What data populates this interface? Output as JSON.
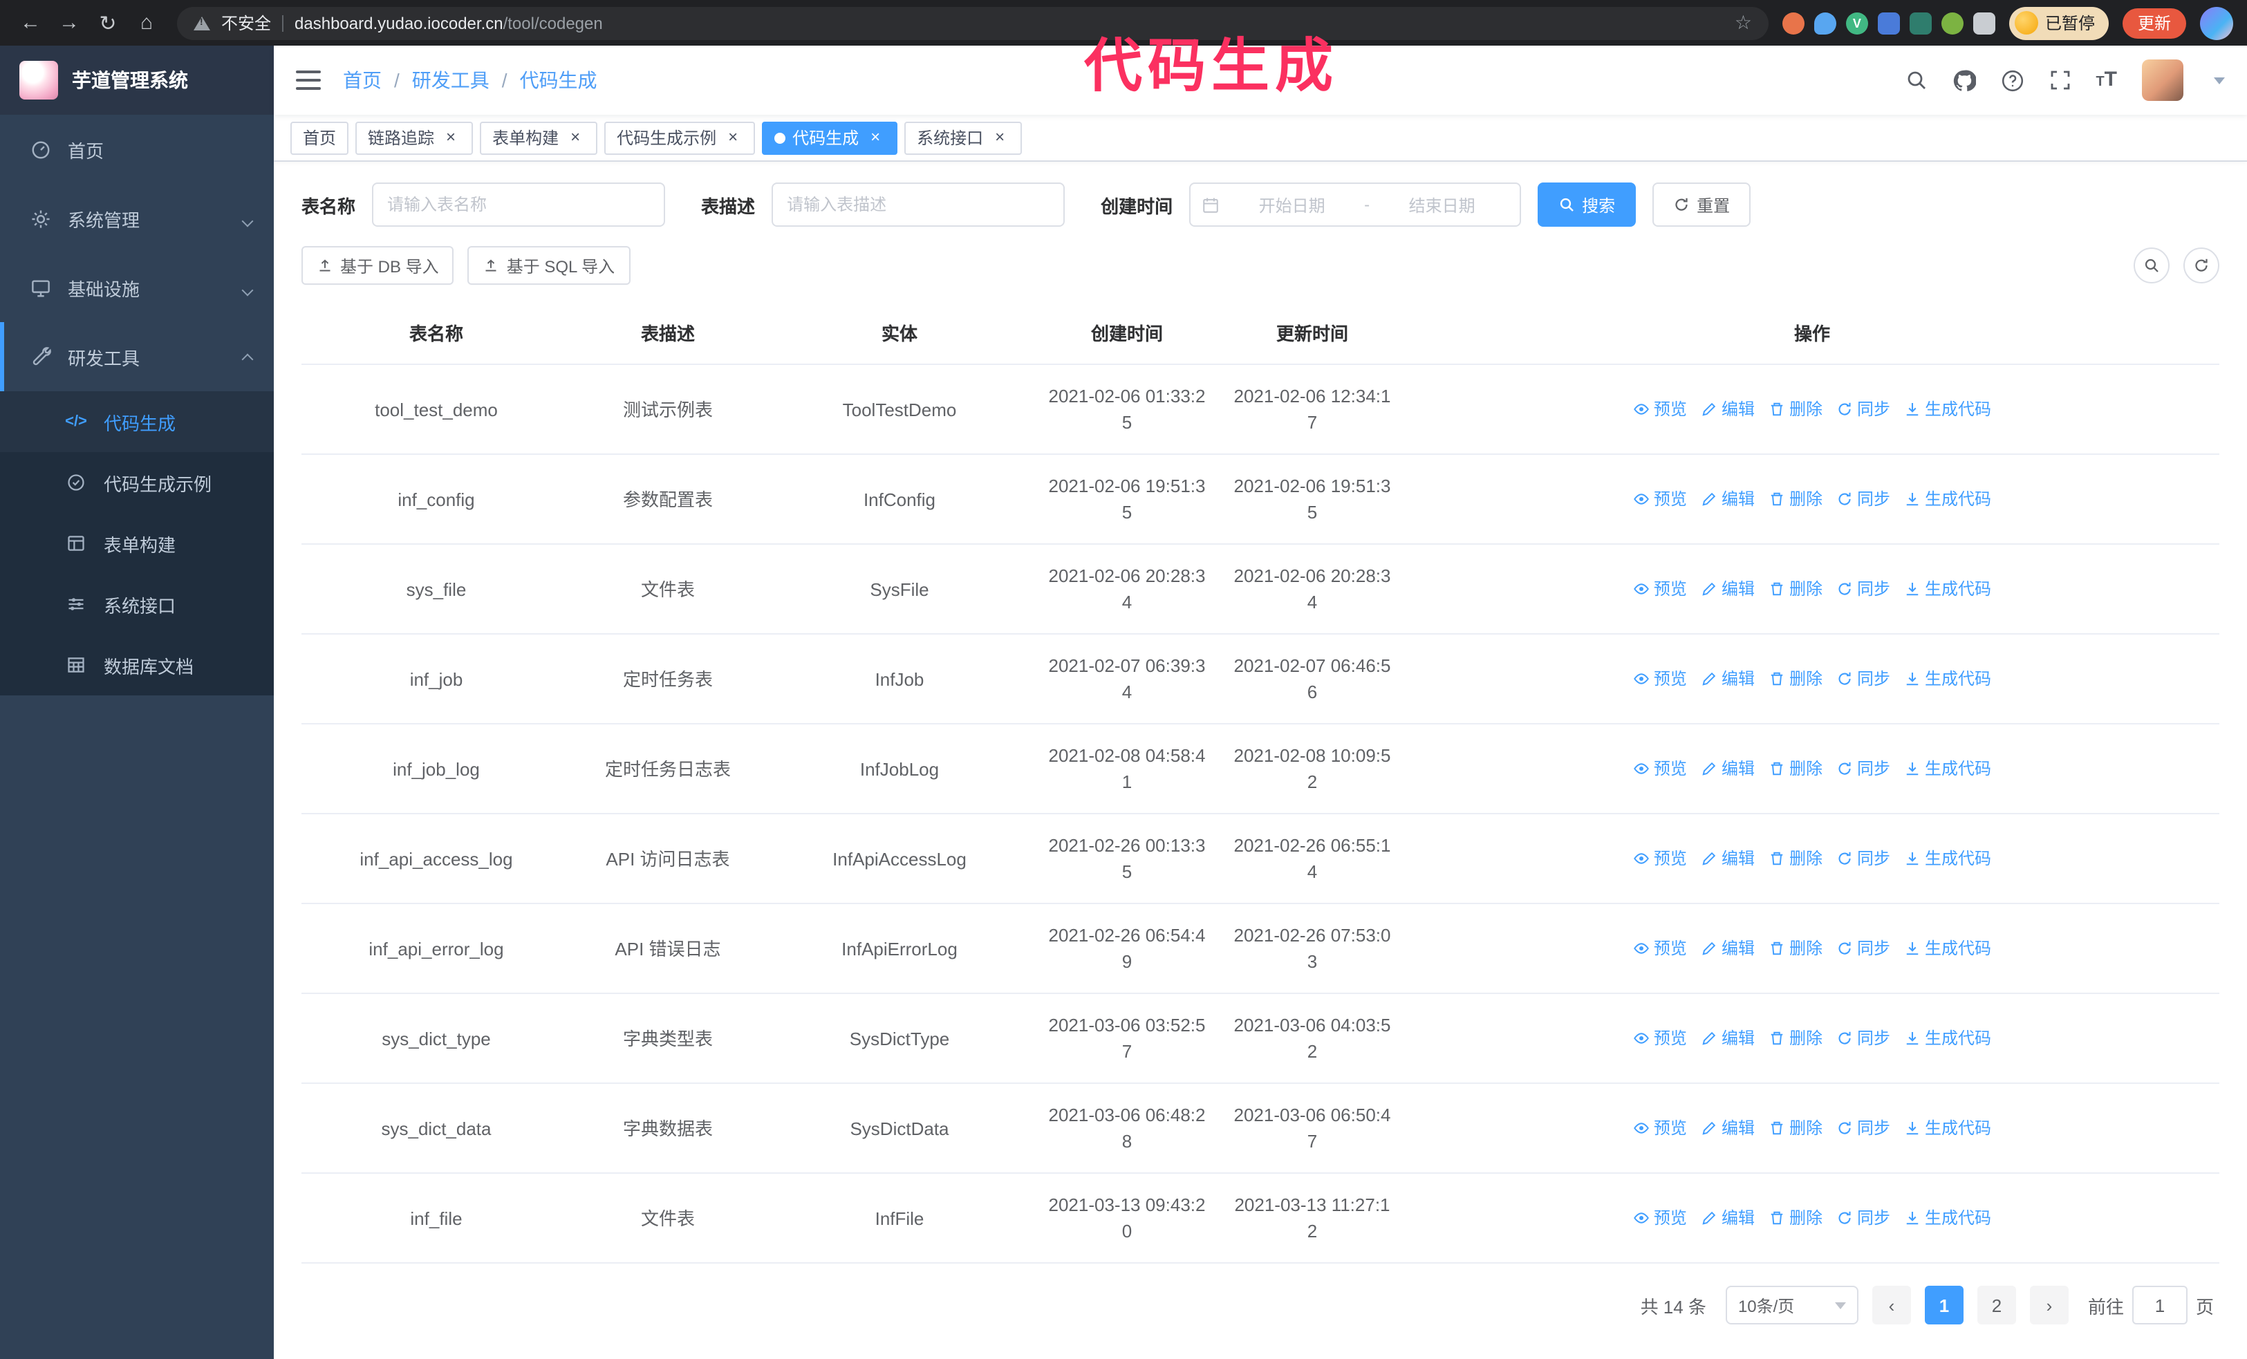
{
  "annotation": {
    "text": "代码生成",
    "color": "#fb3060"
  },
  "colors": {
    "accent": "#409eff",
    "sidebar_bg": "#304156",
    "submenu_bg": "#1f2d3d"
  },
  "icons": {
    "back": "←",
    "forward": "→",
    "reload": "↻",
    "home": "⌂",
    "star": "☆"
  },
  "browser": {
    "security_label": "不安全",
    "url_domain": "dashboard.yudao.iocoder.cn",
    "url_path": "/tool/codegen",
    "profile_chip_label": "已暂停",
    "update_button_label": "更新",
    "update_button_color": "#e8583f",
    "extensions": [
      {
        "name": "extension-orange-icon",
        "color": "#e8744a",
        "shape": "circle",
        "glyph": ""
      },
      {
        "name": "extension-drop-icon",
        "color": "#58a6f0",
        "shape": "drop",
        "glyph": ""
      },
      {
        "name": "vue-devtools-icon",
        "color": "#41b883",
        "shape": "circle",
        "glyph": "V"
      },
      {
        "name": "extension-grid-icon",
        "color": "#4a7bd9",
        "shape": "square",
        "glyph": ""
      },
      {
        "name": "extension-chart-icon",
        "color": "#2f7d6d",
        "shape": "square",
        "glyph": ""
      },
      {
        "name": "extension-leaf-icon",
        "color": "#7cb342",
        "shape": "circle",
        "glyph": ""
      },
      {
        "name": "extensions-puzzle-icon",
        "color": "#c9cdd2",
        "shape": "square",
        "glyph": ""
      }
    ]
  },
  "sidebar": {
    "title": "芋道管理系统",
    "menu": [
      {
        "label": "首页",
        "icon": "dashboard-icon",
        "leaf": true,
        "expanded": false
      },
      {
        "label": "系统管理",
        "icon": "gear-icon",
        "leaf": false,
        "expanded": false
      },
      {
        "label": "基础设施",
        "icon": "monitor-icon",
        "leaf": false,
        "expanded": false
      },
      {
        "label": "研发工具",
        "icon": "tools-icon",
        "leaf": false,
        "expanded": true,
        "children": [
          {
            "label": "代码生成",
            "icon": "code-icon",
            "active": true
          },
          {
            "label": "代码生成示例",
            "icon": "badge-check-icon",
            "active": false
          },
          {
            "label": "表单构建",
            "icon": "form-icon",
            "active": false
          },
          {
            "label": "系统接口",
            "icon": "sliders-icon",
            "active": false
          },
          {
            "label": "数据库文档",
            "icon": "table-grid-icon",
            "active": false
          }
        ]
      }
    ]
  },
  "header": {
    "breadcrumb": [
      "首页",
      "研发工具",
      "代码生成"
    ],
    "separator": "/"
  },
  "tags_view": [
    {
      "label": "首页",
      "closable": false,
      "active": false
    },
    {
      "label": "链路追踪",
      "closable": true,
      "active": false
    },
    {
      "label": "表单构建",
      "closable": true,
      "active": false
    },
    {
      "label": "代码生成示例",
      "closable": true,
      "active": false
    },
    {
      "label": "代码生成",
      "closable": true,
      "active": true
    },
    {
      "label": "系统接口",
      "closable": true,
      "active": false
    }
  ],
  "filters": {
    "name_label": "表名称",
    "name_placeholder": "请输入表名称",
    "desc_label": "表描述",
    "desc_placeholder": "请输入表描述",
    "time_label": "创建时间",
    "start_placeholder": "开始日期",
    "range_separator": "-",
    "end_placeholder": "结束日期",
    "search_label": "搜索",
    "reset_label": "重置"
  },
  "toolbar": {
    "import_db_label": "基于 DB 导入",
    "import_sql_label": "基于 SQL 导入"
  },
  "table": {
    "columns": [
      "表名称",
      "表描述",
      "实体",
      "创建时间",
      "更新时间",
      "操作"
    ],
    "action_labels": [
      "预览",
      "编辑",
      "删除",
      "同步",
      "生成代码"
    ],
    "rows": [
      {
        "name": "tool_test_demo",
        "desc": "测试示例表",
        "entity": "ToolTestDemo",
        "created": "2021-02-06 01:33:25",
        "updated": "2021-02-06 12:34:17"
      },
      {
        "name": "inf_config",
        "desc": "参数配置表",
        "entity": "InfConfig",
        "created": "2021-02-06 19:51:35",
        "updated": "2021-02-06 19:51:35"
      },
      {
        "name": "sys_file",
        "desc": "文件表",
        "entity": "SysFile",
        "created": "2021-02-06 20:28:34",
        "updated": "2021-02-06 20:28:34"
      },
      {
        "name": "inf_job",
        "desc": "定时任务表",
        "entity": "InfJob",
        "created": "2021-02-07 06:39:34",
        "updated": "2021-02-07 06:46:56"
      },
      {
        "name": "inf_job_log",
        "desc": "定时任务日志表",
        "entity": "InfJobLog",
        "created": "2021-02-08 04:58:41",
        "updated": "2021-02-08 10:09:52"
      },
      {
        "name": "inf_api_access_log",
        "desc": "API 访问日志表",
        "entity": "InfApiAccessLog",
        "created": "2021-02-26 00:13:35",
        "updated": "2021-02-26 06:55:14"
      },
      {
        "name": "inf_api_error_log",
        "desc": "API 错误日志",
        "entity": "InfApiErrorLog",
        "created": "2021-02-26 06:54:49",
        "updated": "2021-02-26 07:53:03"
      },
      {
        "name": "sys_dict_type",
        "desc": "字典类型表",
        "entity": "SysDictType",
        "created": "2021-03-06 03:52:57",
        "updated": "2021-03-06 04:03:52"
      },
      {
        "name": "sys_dict_data",
        "desc": "字典数据表",
        "entity": "SysDictData",
        "created": "2021-03-06 06:48:28",
        "updated": "2021-03-06 06:50:47"
      },
      {
        "name": "inf_file",
        "desc": "文件表",
        "entity": "InfFile",
        "created": "2021-03-13 09:43:20",
        "updated": "2021-03-13 11:27:12"
      }
    ]
  },
  "pagination": {
    "total_text": "共 14 条",
    "page_size_text": "10条/页",
    "pages": [
      "1",
      "2"
    ],
    "active_page": "1",
    "goto_prefix": "前往",
    "goto_value": "1",
    "goto_suffix": "页"
  }
}
